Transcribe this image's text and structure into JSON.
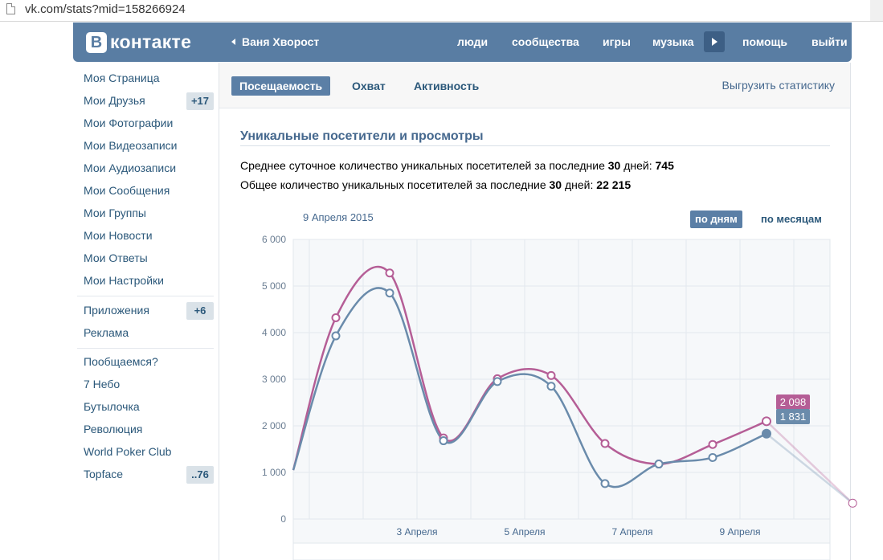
{
  "browser": {
    "url": "vk.com/stats?mid=158266924"
  },
  "header": {
    "logo_letter": "В",
    "logo_text": "контакте",
    "back_label": "Ваня Хворост",
    "nav": [
      "люди",
      "сообщества",
      "игры",
      "музыка",
      "помощь",
      "выйти"
    ]
  },
  "sidebar": {
    "items": [
      {
        "label": "Моя Страница"
      },
      {
        "label": "Мои Друзья",
        "badge": "+17"
      },
      {
        "label": "Мои Фотографии"
      },
      {
        "label": "Мои Видеозаписи"
      },
      {
        "label": "Мои Аудиозаписи"
      },
      {
        "label": "Мои Сообщения"
      },
      {
        "label": "Мои Группы"
      },
      {
        "label": "Мои Новости"
      },
      {
        "label": "Мои Ответы"
      },
      {
        "label": "Мои Настройки"
      }
    ],
    "apps": [
      {
        "label": "Приложения",
        "badge": "+6"
      },
      {
        "label": "Реклама"
      }
    ],
    "games": [
      {
        "label": "Пообщаемся?"
      },
      {
        "label": "7 Небо"
      },
      {
        "label": "Бутылочка"
      },
      {
        "label": "Революция"
      },
      {
        "label": "World Poker Club"
      },
      {
        "label": "Topface",
        "badge": "..76"
      }
    ]
  },
  "stats": {
    "tabs": [
      "Посещаемость",
      "Охват",
      "Активность"
    ],
    "active_tab": "Посещаемость",
    "export_label": "Выгрузить статистику",
    "section_title": "Уникальные посетители и просмотры",
    "avg_prefix": "Среднее суточное количество уникальных посетителей за последние ",
    "avg_days": "30",
    "avg_mid": " дней: ",
    "avg_value": "745",
    "total_prefix": "Общее количество уникальных посетителей за последние ",
    "total_days": "30",
    "total_mid": " дней: ",
    "total_value": "22 215",
    "chart_date": "9 Апреля 2015",
    "period_day": "по дням",
    "period_month": "по месяцам",
    "tooltip_views": "2 098",
    "tooltip_visitors": "1 831"
  },
  "colors": {
    "header": "#597da3",
    "link": "#2b587a",
    "views_series": "#b55e96",
    "visitors_series": "#6a8bab"
  },
  "chart_data": {
    "type": "line",
    "x_labels": [
      "3 Апреля",
      "5 Апреля",
      "7 Апреля",
      "9 Апреля"
    ],
    "ylim": [
      0,
      6000
    ],
    "y_ticks": [
      "0",
      "1 000",
      "2 000",
      "3 000",
      "4 000",
      "5 000",
      "6 000"
    ],
    "x_day_range": [
      31.5,
      10.6
    ],
    "series": [
      {
        "color": "#b55e96",
        "x": [
          31.5,
          1,
          2,
          3,
          4,
          5,
          6,
          7,
          8,
          9,
          10.6
        ],
        "values": [
          1050,
          4320,
          5280,
          1740,
          3010,
          3080,
          1620,
          1180,
          1600,
          2098,
          340
        ]
      },
      {
        "color": "#6a8bab",
        "x": [
          31.5,
          1,
          2,
          3,
          4,
          5,
          6,
          7,
          8,
          9,
          10.6
        ],
        "values": [
          1050,
          3930,
          4850,
          1680,
          2950,
          2850,
          760,
          1180,
          1320,
          1831,
          340
        ]
      }
    ]
  }
}
